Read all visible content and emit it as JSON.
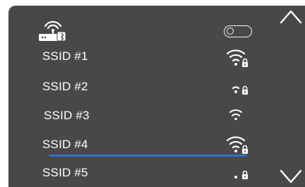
{
  "header": {
    "router_icon": "wifi-router-icon",
    "wifi_toggle": {
      "state": "off",
      "icon": "toggle-switch-icon"
    }
  },
  "scroll": {
    "up_icon": "chevron-up-icon",
    "down_icon": "chevron-down-icon"
  },
  "networks": [
    {
      "ssid": "SSID #1",
      "signal_bars": 3,
      "locked": true
    },
    {
      "ssid": "SSID #2",
      "signal_bars": 2,
      "locked": true
    },
    {
      "ssid": "SSID #3",
      "signal_bars": 2,
      "locked": false
    },
    {
      "ssid": "SSID #4",
      "signal_bars": 3,
      "locked": true,
      "highlighted": true
    },
    {
      "ssid": "SSID #5",
      "signal_bars": 1,
      "locked": true
    }
  ],
  "colors": {
    "panel": "#4a4847",
    "text": "#ffffff",
    "highlight": "#2f6fd1"
  }
}
